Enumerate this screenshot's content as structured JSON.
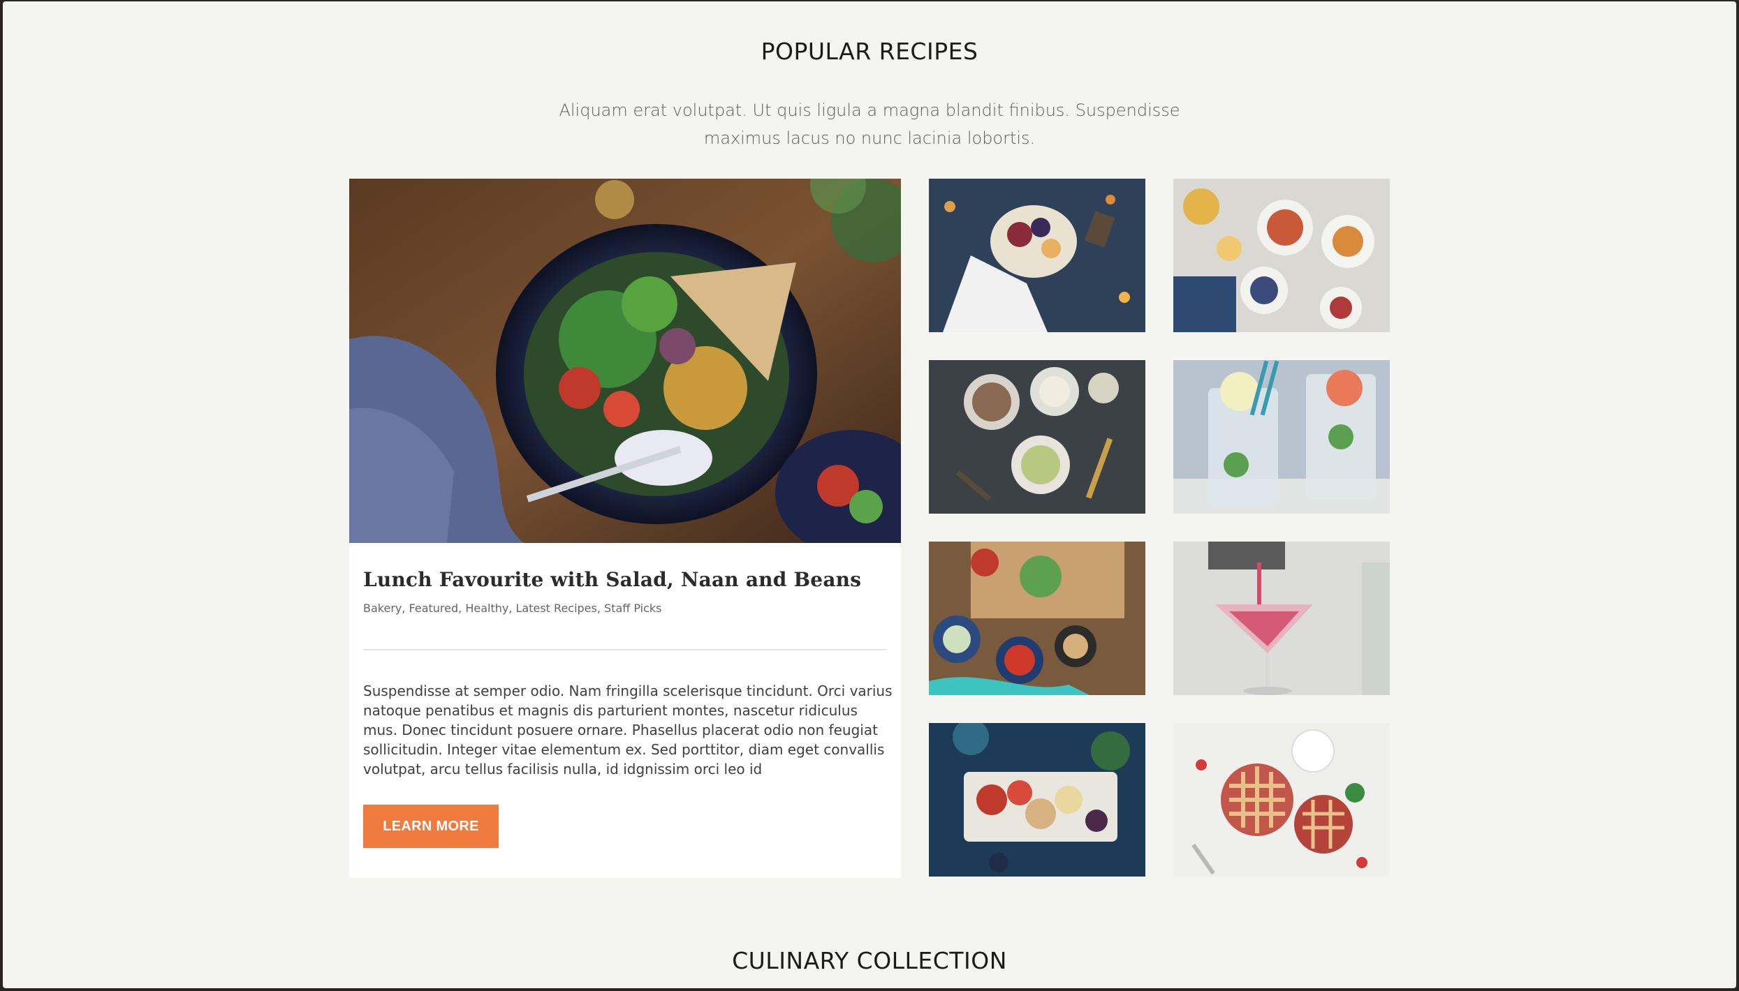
{
  "section": {
    "title": "POPULAR RECIPES",
    "intro": "Aliquam erat volutpat. Ut quis ligula a magna blandit finibus. Suspendisse maximus lacus no nunc lacinia lobortis."
  },
  "featured": {
    "title": "Lunch Favourite with Salad, Naan and Beans",
    "categories": "Bakery, Featured, Healthy, Latest Recipes, Staff Picks",
    "body": "Suspendisse at semper odio. Nam fringilla scelerisque tincidunt. Orci varius natoque penatibus et magnis dis parturient montes, nascetur ridiculus mus. Donec tincidunt posuere ornare. Phasellus placerat odio non feugiat sollicitudin. Integer vitae elementum ex. Sed porttitor, diam eget convallis volutpat, arcu tellus facilisis nulla, id idgnissim orci leo id",
    "button_label": "LEARN MORE"
  },
  "next_section": {
    "title": "CULINARY COLLECTION"
  },
  "colors": {
    "accent": "#f07b3f",
    "page_background": "#f4f4f0",
    "card_background": "#ffffff"
  }
}
